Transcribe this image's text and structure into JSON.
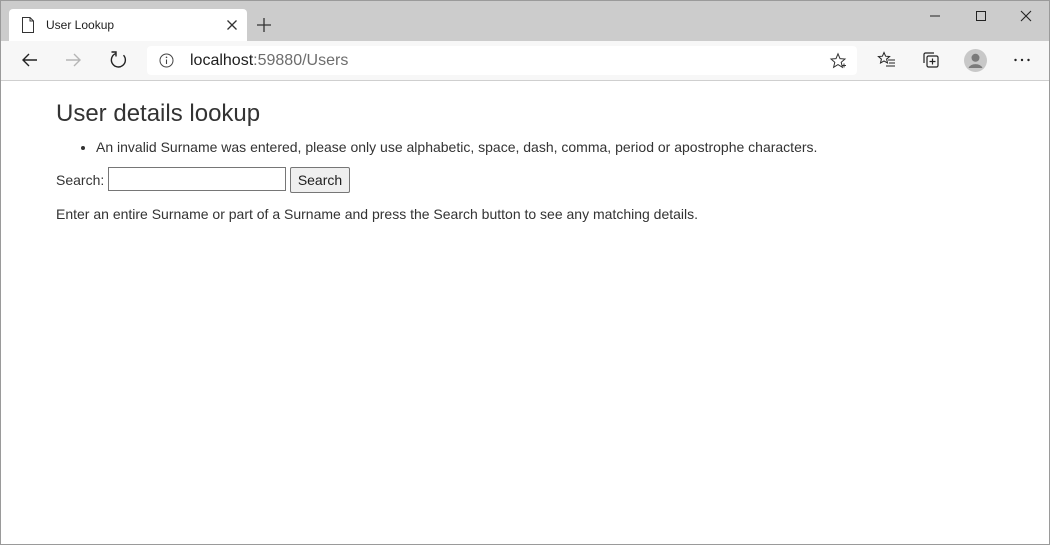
{
  "browser": {
    "tab_title": "User Lookup",
    "url_host": "localhost",
    "url_path": ":59880/Users"
  },
  "page": {
    "title": "User details lookup",
    "errors": [
      "An invalid Surname was entered, please only use alphabetic, space, dash, comma, period or apostrophe characters."
    ],
    "search": {
      "label": "Search:",
      "value": "",
      "placeholder": "",
      "button_label": "Search"
    },
    "help_text": "Enter an entire Surname or part of a Surname and press the Search button to see any matching details."
  },
  "icons": {
    "tab": "page-icon",
    "tab_close": "close-icon",
    "new_tab": "plus-icon",
    "minimize": "minimize-icon",
    "maximize": "maximize-icon",
    "close": "close-icon",
    "back": "back-arrow-icon",
    "forward": "forward-arrow-icon",
    "refresh": "refresh-icon",
    "info": "info-icon",
    "favorite": "star-icon",
    "favorites": "favorites-icon",
    "collections": "collections-icon",
    "profile": "profile-icon",
    "more": "more-icon"
  },
  "colors": {
    "tabstrip": "#cccccc",
    "toolbar": "#f7f7f7",
    "text": "#333333"
  }
}
